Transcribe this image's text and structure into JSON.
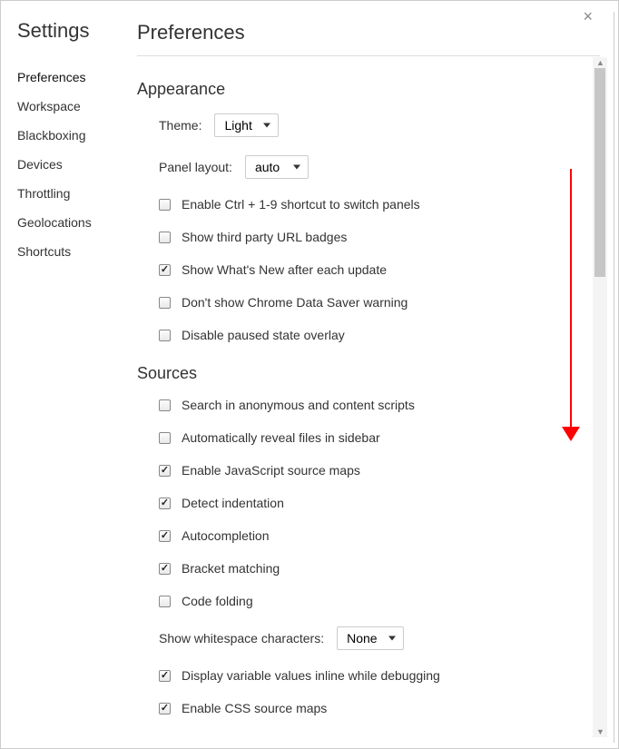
{
  "sidebar": {
    "title": "Settings",
    "items": [
      {
        "label": "Preferences",
        "active": true
      },
      {
        "label": "Workspace",
        "active": false
      },
      {
        "label": "Blackboxing",
        "active": false
      },
      {
        "label": "Devices",
        "active": false
      },
      {
        "label": "Throttling",
        "active": false
      },
      {
        "label": "Geolocations",
        "active": false
      },
      {
        "label": "Shortcuts",
        "active": false
      }
    ]
  },
  "main": {
    "title": "Preferences",
    "close_icon": "×"
  },
  "appearance": {
    "title": "Appearance",
    "theme_label": "Theme:",
    "theme_value": "Light",
    "panel_label": "Panel layout:",
    "panel_value": "auto",
    "checks": [
      {
        "label": "Enable Ctrl + 1-9 shortcut to switch panels",
        "checked": false
      },
      {
        "label": "Show third party URL badges",
        "checked": false
      },
      {
        "label": "Show What's New after each update",
        "checked": true
      },
      {
        "label": "Don't show Chrome Data Saver warning",
        "checked": false
      },
      {
        "label": "Disable paused state overlay",
        "checked": false
      }
    ]
  },
  "sources": {
    "title": "Sources",
    "checks": [
      {
        "label": "Search in anonymous and content scripts",
        "checked": false
      },
      {
        "label": "Automatically reveal files in sidebar",
        "checked": false
      },
      {
        "label": "Enable JavaScript source maps",
        "checked": true
      },
      {
        "label": "Detect indentation",
        "checked": true
      },
      {
        "label": "Autocompletion",
        "checked": true
      },
      {
        "label": "Bracket matching",
        "checked": true
      },
      {
        "label": "Code folding",
        "checked": false
      }
    ],
    "whitespace_label": "Show whitespace characters:",
    "whitespace_value": "None",
    "checks2": [
      {
        "label": "Display variable values inline while debugging",
        "checked": true
      },
      {
        "label": "Enable CSS source maps",
        "checked": true
      }
    ]
  }
}
